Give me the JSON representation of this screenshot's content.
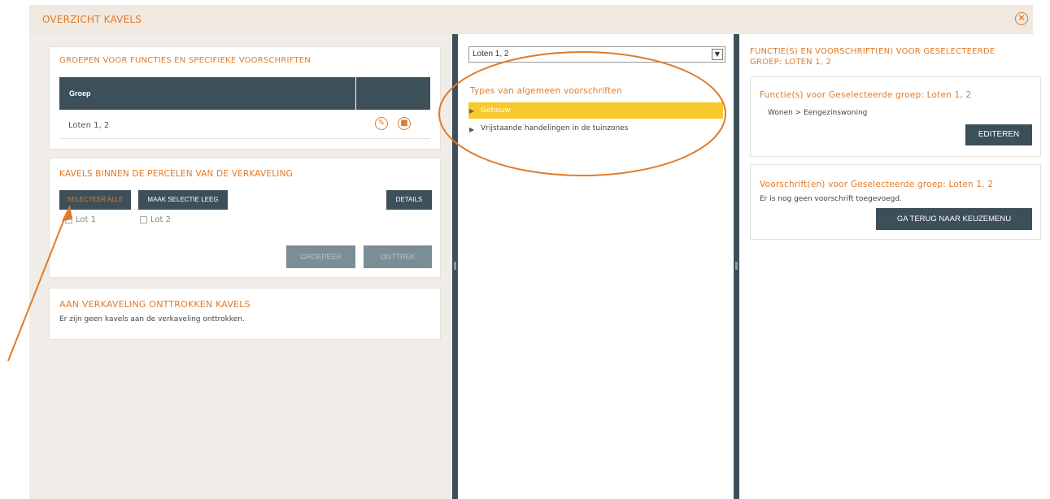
{
  "window": {
    "title": "OVERZICHT KAVELS"
  },
  "groups_panel": {
    "title": "GROEPEN VOOR FUNCTIES EN SPECIFIEKE VOORSCHRIFTEN",
    "column_header": "Groep",
    "rows": [
      {
        "name": "Loten 1, 2"
      }
    ]
  },
  "kavels_panel": {
    "title": "KAVELS BINNEN DE PERCELEN VAN DE VERKAVELING",
    "select_all_label": "SELECTEER ALLE",
    "clear_selection_label": "MAAK SELECTIE LEEG",
    "details_label": "DETAILS",
    "lots": [
      "Lot 1",
      "Lot 2"
    ],
    "group_label": "GROEPEER",
    "withdraw_label": "ONTTREK"
  },
  "withdrawn_panel": {
    "title": "AAN VERKAVELING ONTTROKKEN KAVELS",
    "message": "Er zijn geen kavels aan de verkaveling onttrokken."
  },
  "middle": {
    "group_select_value": "Loten 1, 2",
    "types_title": "Types van algemeen voorschriften",
    "types": [
      "Gebouw",
      "Vrijstaande handelingen in de tuinzones"
    ]
  },
  "right": {
    "title_line1": "FUNCTIE(S) EN VOORSCHRIFT(EN) VOOR GESELECTEERDE",
    "title_line2": "GROEP: LOTEN 1, 2",
    "functions_title": "Functie(s) voor Geselecteerde groep: Loten 1, 2",
    "function_value": "Wonen > Eengezinswoning",
    "edit_label": "EDITEREN",
    "rules_title": "Voorschrift(en) voor Geselecteerde groep: Loten 1, 2",
    "rules_message": "Er is nog geen voorschrift toegevoegd.",
    "back_label": "GA TERUG NAAR KEUZEMENU"
  },
  "colors": {
    "accent": "#e07b2a",
    "dark": "#3d4f59",
    "highlight": "#f8c92d"
  },
  "icons": {
    "close": "close-circle-icon",
    "edit": "pencil-icon",
    "delete": "trash-icon",
    "dropdown": "chevron-down-icon"
  }
}
